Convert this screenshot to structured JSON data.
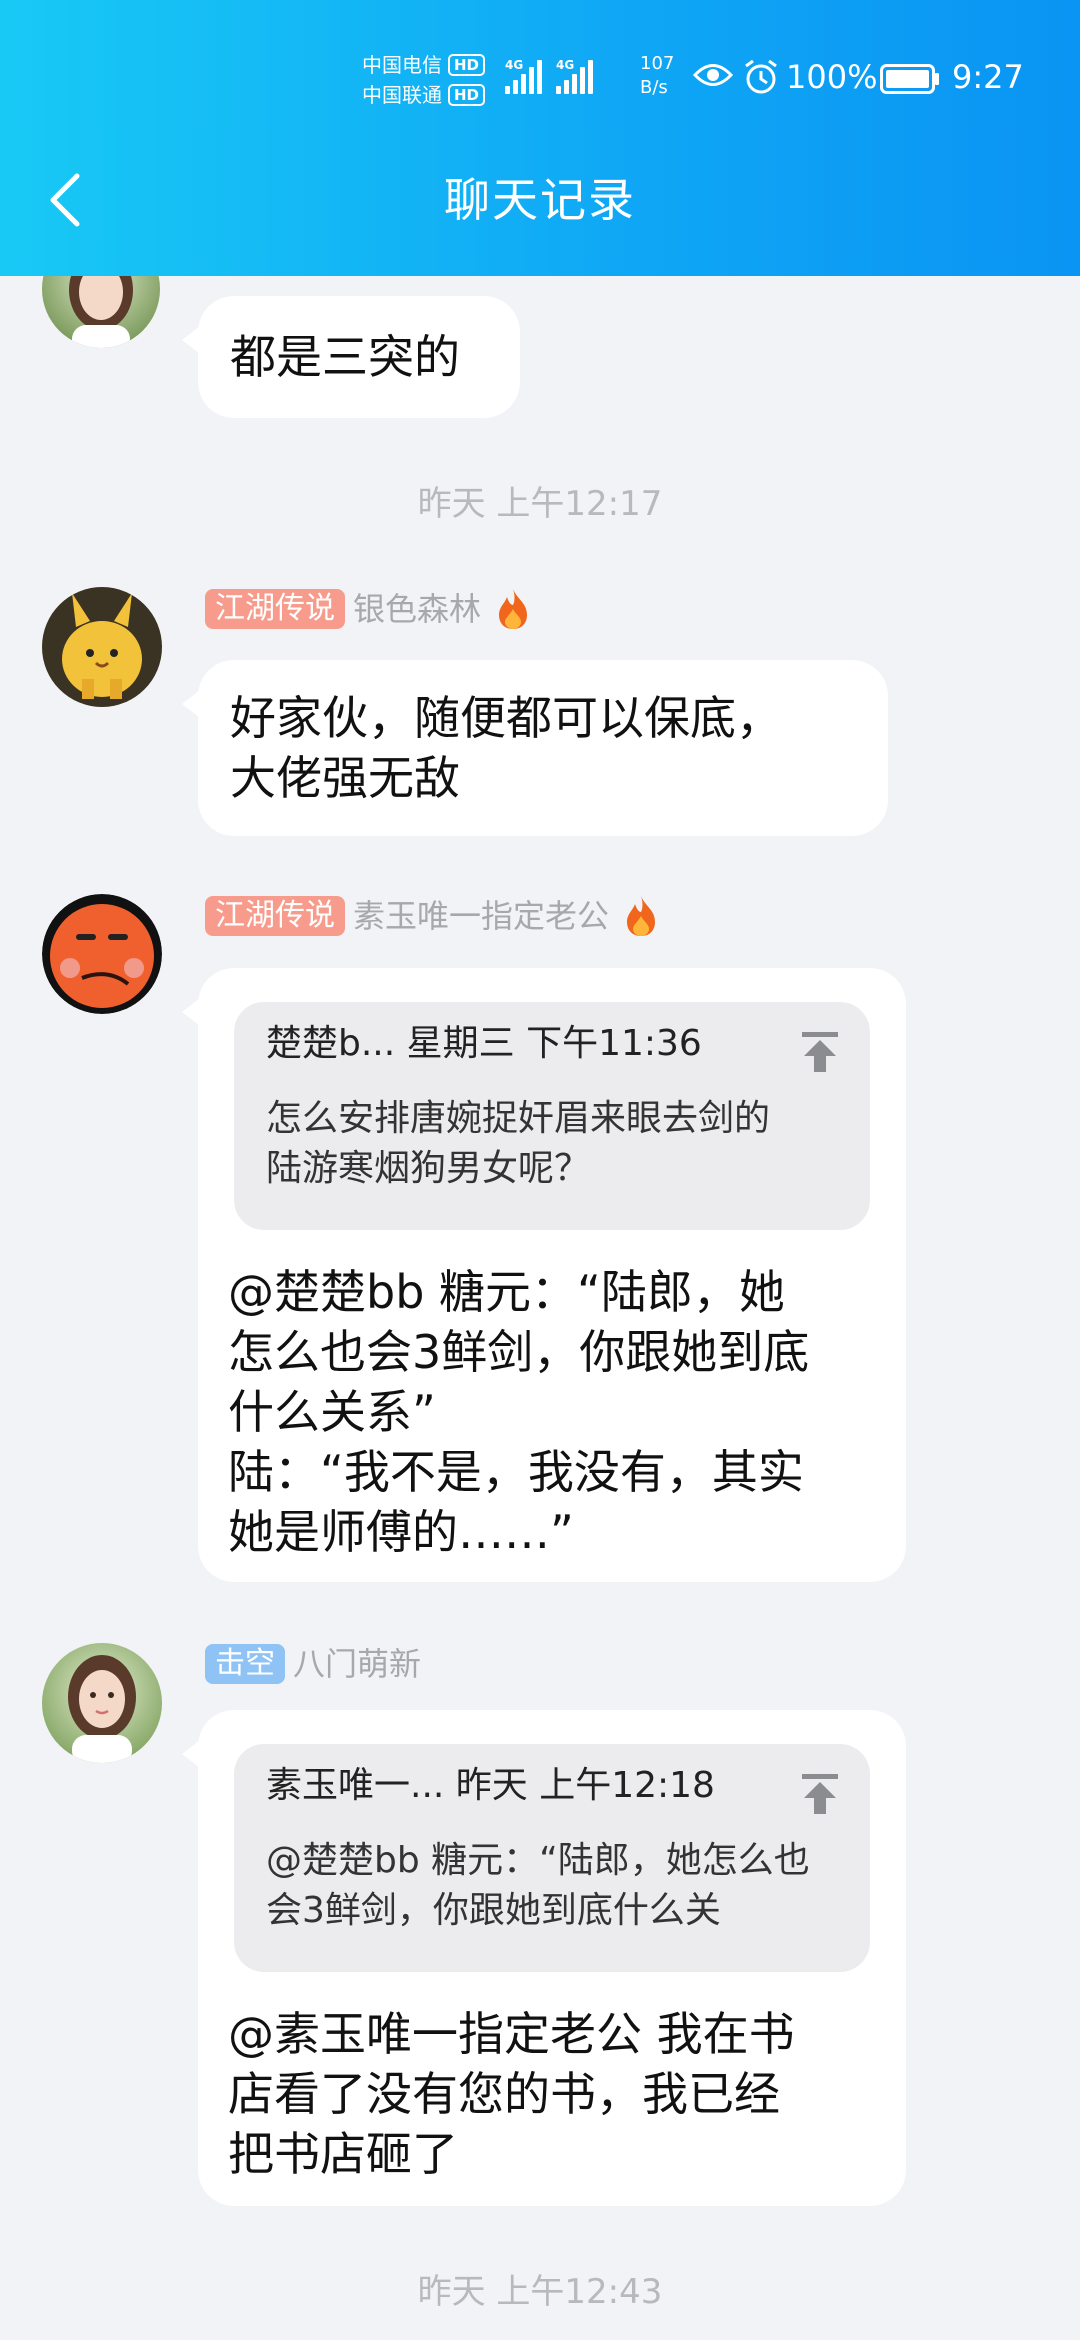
{
  "status_bar": {
    "carrier1": "中国电信",
    "carrier2": "中国联通",
    "hd": "HD",
    "net_type": "4G",
    "net_speed_value": "107",
    "net_speed_unit": "B/s",
    "battery": "100%",
    "time": "9:27"
  },
  "header": {
    "title": "聊天记录",
    "back_icon": "chevron-left-icon"
  },
  "messages": [
    {
      "text": "都是三突的"
    },
    {
      "timestamp": "昨天 上午12:17"
    },
    {
      "badge": "江湖传说",
      "badge_color": "#f79c8c",
      "name": "银色森林",
      "text": "好家伙，随便都可以保底，\n大佬强无敌"
    },
    {
      "badge": "江湖传说",
      "badge_color": "#f79c8c",
      "name": "素玉唯一指定老公",
      "quote_head": "楚楚b... 星期三 下午11:36",
      "quote_body": "怎么安排唐婉捉奸眉来眼去剑的\n陆游寒烟狗男女呢？",
      "text": "@楚楚bb 糖元：“陆郎，她\n怎么也会3鲜剑，你跟她到底\n什么关系”\n陆：“我不是，我没有，其实\n她是师傅的……”"
    },
    {
      "badge": "击空",
      "badge_color": "#8fc3f5",
      "name": "八门萌新",
      "quote_head": "素玉唯一... 昨天 上午12:18",
      "quote_body": "@楚楚bb 糖元：“陆郎，她怎么也\n会3鲜剑，你跟她到底什么关",
      "text": "@素玉唯一指定老公 我在书\n店看了没有您的书，我已经\n把书店砸了"
    },
    {
      "timestamp": "昨天 上午12:43"
    }
  ],
  "colors": {
    "header_start": "#18c9f5",
    "header_end": "#0a94f3",
    "background": "#f2f3f7",
    "bubble": "#ffffff",
    "quote_bg": "#ececef",
    "timestamp": "#b7b9bf"
  }
}
